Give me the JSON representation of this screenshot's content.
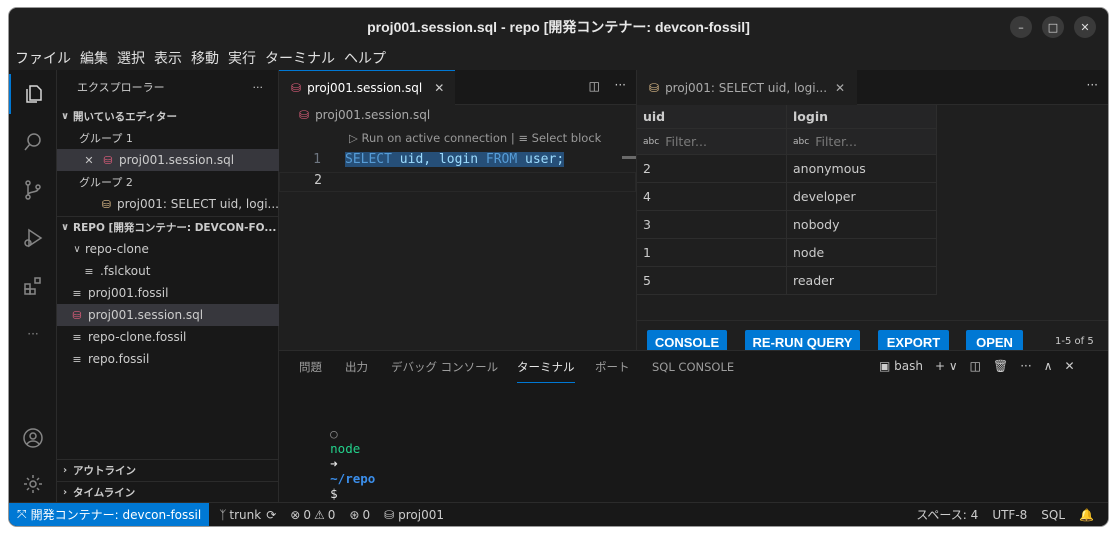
{
  "window": {
    "title": "proj001.session.sql - repo [開発コンテナー: devcon-fossil]"
  },
  "menu": [
    "ファイル",
    "編集",
    "選択",
    "表示",
    "移動",
    "実行",
    "ターミナル",
    "ヘルプ"
  ],
  "sidebar": {
    "title": "エクスプローラー",
    "more": "···",
    "open_editors": "開いているエディター",
    "group1": "グループ 1",
    "group1_file": "proj001.session.sql",
    "group2": "グループ 2",
    "group2_file": "proj001: SELECT uid, logi...",
    "repo_header": "REPO [開発コンテナー: DEVCON-FO...",
    "tree": [
      {
        "label": "repo-clone"
      },
      {
        "label": ".fslckout"
      },
      {
        "label": "proj001.fossil"
      },
      {
        "label": "proj001.session.sql"
      },
      {
        "label": "repo-clone.fossil"
      },
      {
        "label": "repo.fossil"
      }
    ],
    "outline": "アウトライン",
    "timeline": "タイムライン"
  },
  "editor": {
    "tab_label": "proj001.session.sql",
    "breadcrumb": "proj001.session.sql",
    "codelens_run": "Run on active connection",
    "codelens_sep": "|",
    "codelens_select": "Select block",
    "lines": [
      {
        "num": "1",
        "kw1": "SELECT",
        "t1": " uid, login ",
        "kw2": "FROM",
        "t2": " user;"
      },
      {
        "num": "2"
      }
    ]
  },
  "results": {
    "tab_label": "proj001: SELECT uid, logi...",
    "more": "···",
    "columns": [
      "uid",
      "login"
    ],
    "filter_placeholder": "Filter...",
    "rows": [
      {
        "uid": "2",
        "login": "anonymous"
      },
      {
        "uid": "4",
        "login": "developer"
      },
      {
        "uid": "3",
        "login": "nobody"
      },
      {
        "uid": "1",
        "login": "node"
      },
      {
        "uid": "5",
        "login": "reader"
      }
    ],
    "buttons": {
      "console": "CONSOLE",
      "rerun": "RE-RUN QUERY",
      "export": "EXPORT",
      "open": "OPEN"
    },
    "count": "1-5 of 5"
  },
  "panel": {
    "tabs": [
      "問題",
      "出力",
      "デバッグ コンソール",
      "ターミナル",
      "ポート",
      "SQL CONSOLE"
    ],
    "active_tab": "ターミナル",
    "shell": "bash",
    "prompt_user": "node",
    "prompt_arrow": "➜",
    "prompt_path": "~/repo",
    "prompt_symbol": "$"
  },
  "status": {
    "remote": "開発コンテナー: devcon-fossil",
    "branch": "trunk",
    "errors": "0",
    "warnings": "0",
    "ports": "0",
    "connection": "proj001",
    "spaces": "スペース: 4",
    "encoding": "UTF-8",
    "language": "SQL"
  },
  "colors": {
    "accent": "#0078d4",
    "keyword": "#569cd6",
    "prompt_green": "#23d18b",
    "prompt_blue": "#3b8eea"
  }
}
